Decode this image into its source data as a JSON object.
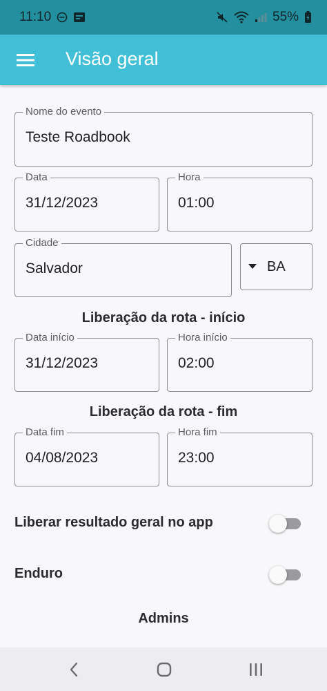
{
  "status_bar": {
    "time": "11:10",
    "battery": "55%",
    "left_icons": [
      "do-not-disturb-icon",
      "notification-app-icon"
    ],
    "right_icons": [
      "mute-icon",
      "wifi-icon",
      "signal-icon",
      "battery-charging-icon"
    ]
  },
  "app_bar": {
    "title": "Visão geral",
    "menu_icon": "hamburger-menu-icon"
  },
  "form": {
    "event_name": {
      "label": "Nome do evento",
      "value": "Teste Roadbook"
    },
    "date": {
      "label": "Data",
      "value": "31/12/2023"
    },
    "time": {
      "label": "Hora",
      "value": "01:00"
    },
    "city": {
      "label": "Cidade",
      "value": "Salvador"
    },
    "state": {
      "value": "BA"
    },
    "route_start_heading": "Liberação da rota - início",
    "start_date": {
      "label": "Data início",
      "value": "31/12/2023"
    },
    "start_time": {
      "label": "Hora início",
      "value": "02:00"
    },
    "route_end_heading": "Liberação da rota - fim",
    "end_date": {
      "label": "Data fim",
      "value": "04/08/2023"
    },
    "end_time": {
      "label": "Hora fim",
      "value": "23:00"
    }
  },
  "toggles": {
    "release_results": {
      "label": "Liberar resultado geral no app",
      "on": false
    },
    "enduro": {
      "label": "Enduro",
      "on": false
    }
  },
  "admins_heading": "Admins",
  "colors": {
    "status_bar": "#248f9f",
    "app_bar": "#41bfd6",
    "background": "#f8f8fa"
  }
}
